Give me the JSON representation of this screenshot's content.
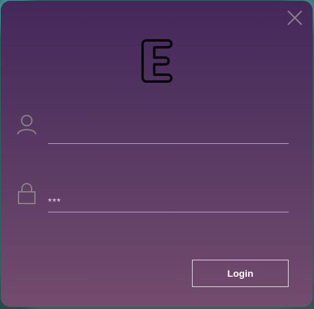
{
  "app": {
    "logo_icon": "letter-e-logo-icon"
  },
  "window": {
    "close_icon": "close-icon"
  },
  "form": {
    "username": {
      "icon": "user-icon",
      "value": ""
    },
    "password": {
      "icon": "lock-icon",
      "value": "***"
    },
    "login_label": "Login"
  },
  "colors": {
    "dialog_top": "#44285a",
    "dialog_bottom": "#734c6e",
    "icon_gray": "#8b7f86",
    "underline": "#b7aab8",
    "button_border": "#e4d9e6"
  }
}
